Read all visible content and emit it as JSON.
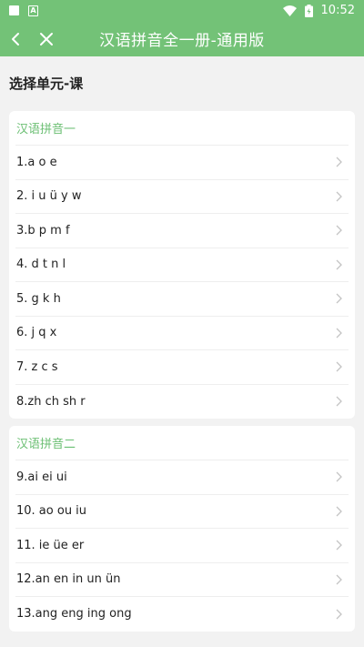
{
  "status_bar": {
    "time": "10:52"
  },
  "header": {
    "title": "汉语拼音全一册-通用版"
  },
  "section_heading": "选择单元-课",
  "units": [
    {
      "title": "汉语拼音一",
      "lessons": [
        "1.a o e",
        "2. i u ü y w",
        "3.b p m f",
        "4. d t n l",
        "5. g k h",
        "6. j q x",
        "7. z c s",
        "8.zh ch sh r"
      ]
    },
    {
      "title": "汉语拼音二",
      "lessons": [
        "9.ai ei ui",
        "10. ao ou iu",
        "11. ie üe er",
        "12.an en in un ün",
        "13.ang eng ing ong"
      ]
    }
  ],
  "colors": {
    "accent": "#73c277",
    "unit_title": "#6bbf73"
  }
}
